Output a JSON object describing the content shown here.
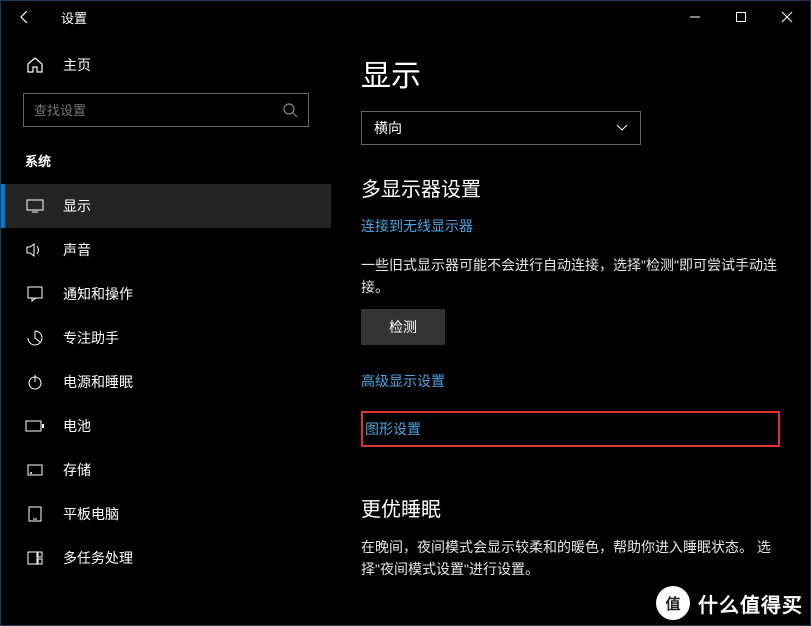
{
  "window": {
    "title": "设置"
  },
  "home_label": "主页",
  "search": {
    "placeholder": "查找设置"
  },
  "section": "系统",
  "nav": [
    {
      "label": "显示"
    },
    {
      "label": "声音"
    },
    {
      "label": "通知和操作"
    },
    {
      "label": "专注助手"
    },
    {
      "label": "电源和睡眠"
    },
    {
      "label": "电池"
    },
    {
      "label": "存储"
    },
    {
      "label": "平板电脑"
    },
    {
      "label": "多任务处理"
    }
  ],
  "main": {
    "heading": "显示",
    "orientation": "横向",
    "multi_heading": "多显示器设置",
    "link_wireless": "连接到无线显示器",
    "desc_detect": "一些旧式显示器可能不会进行自动连接，选择\"检测\"即可尝试手动连接。",
    "btn_detect": "检测",
    "link_advanced": "高级显示设置",
    "link_graphics": "图形设置",
    "sleep_heading": "更优睡眠",
    "sleep_desc": "在晚间，夜间模式会显示较柔和的暖色，帮助你进入睡眠状态。 选择\"夜间模式设置\"进行设置。"
  },
  "watermark": {
    "badge": "值",
    "text": "什么值得买"
  }
}
